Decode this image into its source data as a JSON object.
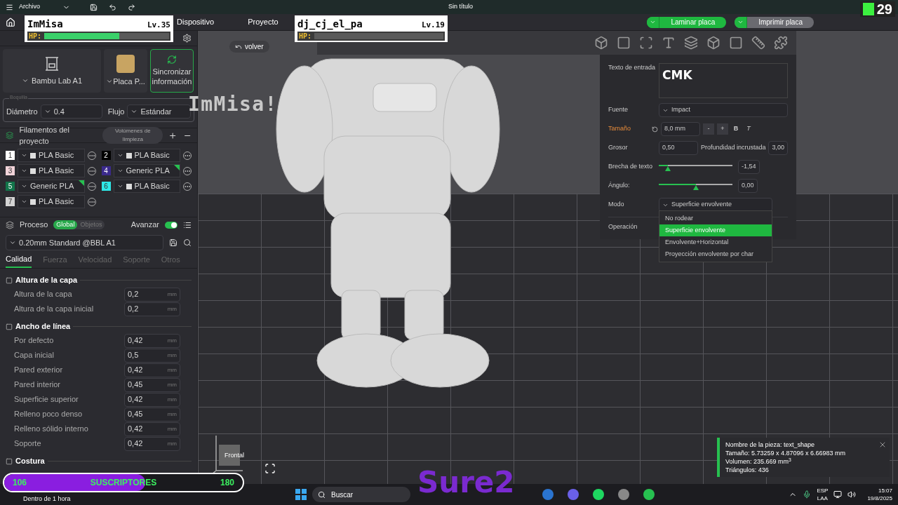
{
  "title_bar": {
    "menu": "Archivo",
    "title": "Sin título"
  },
  "nav_tabs": [
    {
      "label": "Dispositivo",
      "selected": false
    },
    {
      "label": "Proyecto",
      "selected": false
    }
  ],
  "actions": [
    {
      "label": "Laminar placa",
      "kind": "primary"
    },
    {
      "label": "Imprimir placa",
      "kind": "secondary"
    }
  ],
  "printer_panel": {
    "printer": "Bambu Lab A1",
    "plate": "Placa P...",
    "sync": "Sincronizar información",
    "nozzle_legend": "Boquilla",
    "diameter_label": "Diámetro",
    "diameter": "0.4",
    "flow_label": "Flujo",
    "flow": "Estándar"
  },
  "filaments": {
    "title": "Filamentos del proyecto",
    "flush_button": "Volúmenes de limpieza",
    "items": [
      {
        "number": "1",
        "color": "#ffffff",
        "name": "PLA Basic",
        "kind": "bambu",
        "flagged": false
      },
      {
        "number": "2",
        "color": "#000000",
        "name": "PLA Basic",
        "kind": "bambu",
        "flagged": false
      },
      {
        "number": "3",
        "color": "#f2d4da",
        "name": "PLA Basic",
        "kind": "bambu",
        "flagged": false
      },
      {
        "number": "4",
        "color": "#3b2a8c",
        "name": "Generic PLA",
        "kind": "generic",
        "flagged": true
      },
      {
        "number": "5",
        "color": "#12744a",
        "name": "Generic PLA",
        "kind": "generic",
        "flagged": true
      },
      {
        "number": "6",
        "color": "#2ee8e8",
        "name": "PLA Basic",
        "kind": "bambu",
        "flagged": false
      },
      {
        "number": "7",
        "color": "#d4d4d4",
        "name": "PLA Basic",
        "kind": "bambu",
        "flagged": false
      }
    ]
  },
  "process": {
    "title": "Proceso",
    "scopes": [
      {
        "label": "Global",
        "selected": true
      },
      {
        "label": "Objetos",
        "selected": false
      }
    ],
    "advanced_label": "Avanzar",
    "advanced_on": true,
    "preset": "0.20mm Standard @BBL A1",
    "tabs": [
      {
        "label": "Calidad",
        "selected": true
      },
      {
        "label": "Fuerza",
        "selected": false
      },
      {
        "label": "Velocidad",
        "selected": false
      },
      {
        "label": "Soporte",
        "selected": false
      },
      {
        "label": "Otros",
        "selected": false
      }
    ],
    "sections": [
      {
        "title": "Altura de la capa",
        "rows": [
          {
            "label": "Altura de la capa",
            "value": "0,2",
            "unit": "mm"
          },
          {
            "label": "Altura de la capa inicial",
            "value": "0,2",
            "unit": "mm"
          }
        ]
      },
      {
        "title": "Ancho de línea",
        "rows": [
          {
            "label": "Por defecto",
            "value": "0,42",
            "unit": "mm"
          },
          {
            "label": "Capa inicial",
            "value": "0,5",
            "unit": "mm"
          },
          {
            "label": "Pared exterior",
            "value": "0,42",
            "unit": "mm"
          },
          {
            "label": "Pared interior",
            "value": "0,45",
            "unit": "mm"
          },
          {
            "label": "Superficie superior",
            "value": "0,42",
            "unit": "mm"
          },
          {
            "label": "Relleno poco denso",
            "value": "0,45",
            "unit": "mm"
          },
          {
            "label": "Relleno sólido interno",
            "value": "0,42",
            "unit": "mm"
          },
          {
            "label": "Soporte",
            "value": "0,42",
            "unit": "mm"
          }
        ]
      },
      {
        "title": "Costura"
      }
    ]
  },
  "viewport": {
    "back": "volver",
    "view_label": "Frontal"
  },
  "text_tool": {
    "input_label": "Texto de entrada",
    "input": "CMK",
    "font_label": "Fuente",
    "font": "Impact",
    "size_label": "Tamaño",
    "size": "8,0 mm",
    "minus": "-",
    "plus": "+",
    "bold": "B",
    "italic": "T",
    "thickness_label": "Grosor",
    "thickness": "0,50",
    "depth_label": "Profundidad incrustada",
    "depth": "3,00",
    "gap_label": "Brecha de texto",
    "gap_slider": {
      "level": 0.12
    },
    "gap": "-1,54",
    "angle_label": "Ángulo:",
    "angle_slider": {
      "level": 0.5
    },
    "angle": "0,00",
    "mode_label": "Modo",
    "mode": "Superficie envolvente",
    "operation_label": "Operación",
    "mode_options": [
      {
        "label": "No rodear",
        "selected": false
      },
      {
        "label": "Superficie envolvente",
        "selected": true
      },
      {
        "label": "Envolvente+Horizontal",
        "selected": false
      },
      {
        "label": "Proyección envolvente por char",
        "selected": false
      }
    ]
  },
  "info_toast": {
    "lines": [
      "Nombre de la pieza: text_shape",
      "Tamaño: 5.73259 x 4.87096 x 6.66983 mm",
      "Volumen: 235.669 mm$^{3}$",
      "Triángulos: 436"
    ]
  },
  "taskbar": {
    "weather": "Dentro de 1 hora",
    "search": "Buscar",
    "lang": "ESP",
    "region": "LAA",
    "time": "15:07",
    "date": "19/8/2025"
  },
  "stream_overlay": {
    "players": [
      {
        "name": "ImMisa",
        "level_label": "Lv.35",
        "hp_label": "HP:",
        "level": 0.6
      },
      {
        "name": "dj_cj_el_pa",
        "level_label": "Lv.19",
        "hp_label": "HP:",
        "level": 0
      }
    ],
    "shout": "ImMisa!",
    "subs": {
      "current": "106",
      "label": "SUSCRIPTORES",
      "goal": "180",
      "level": 0.59
    },
    "brand": "Sure2",
    "counter": "29"
  }
}
